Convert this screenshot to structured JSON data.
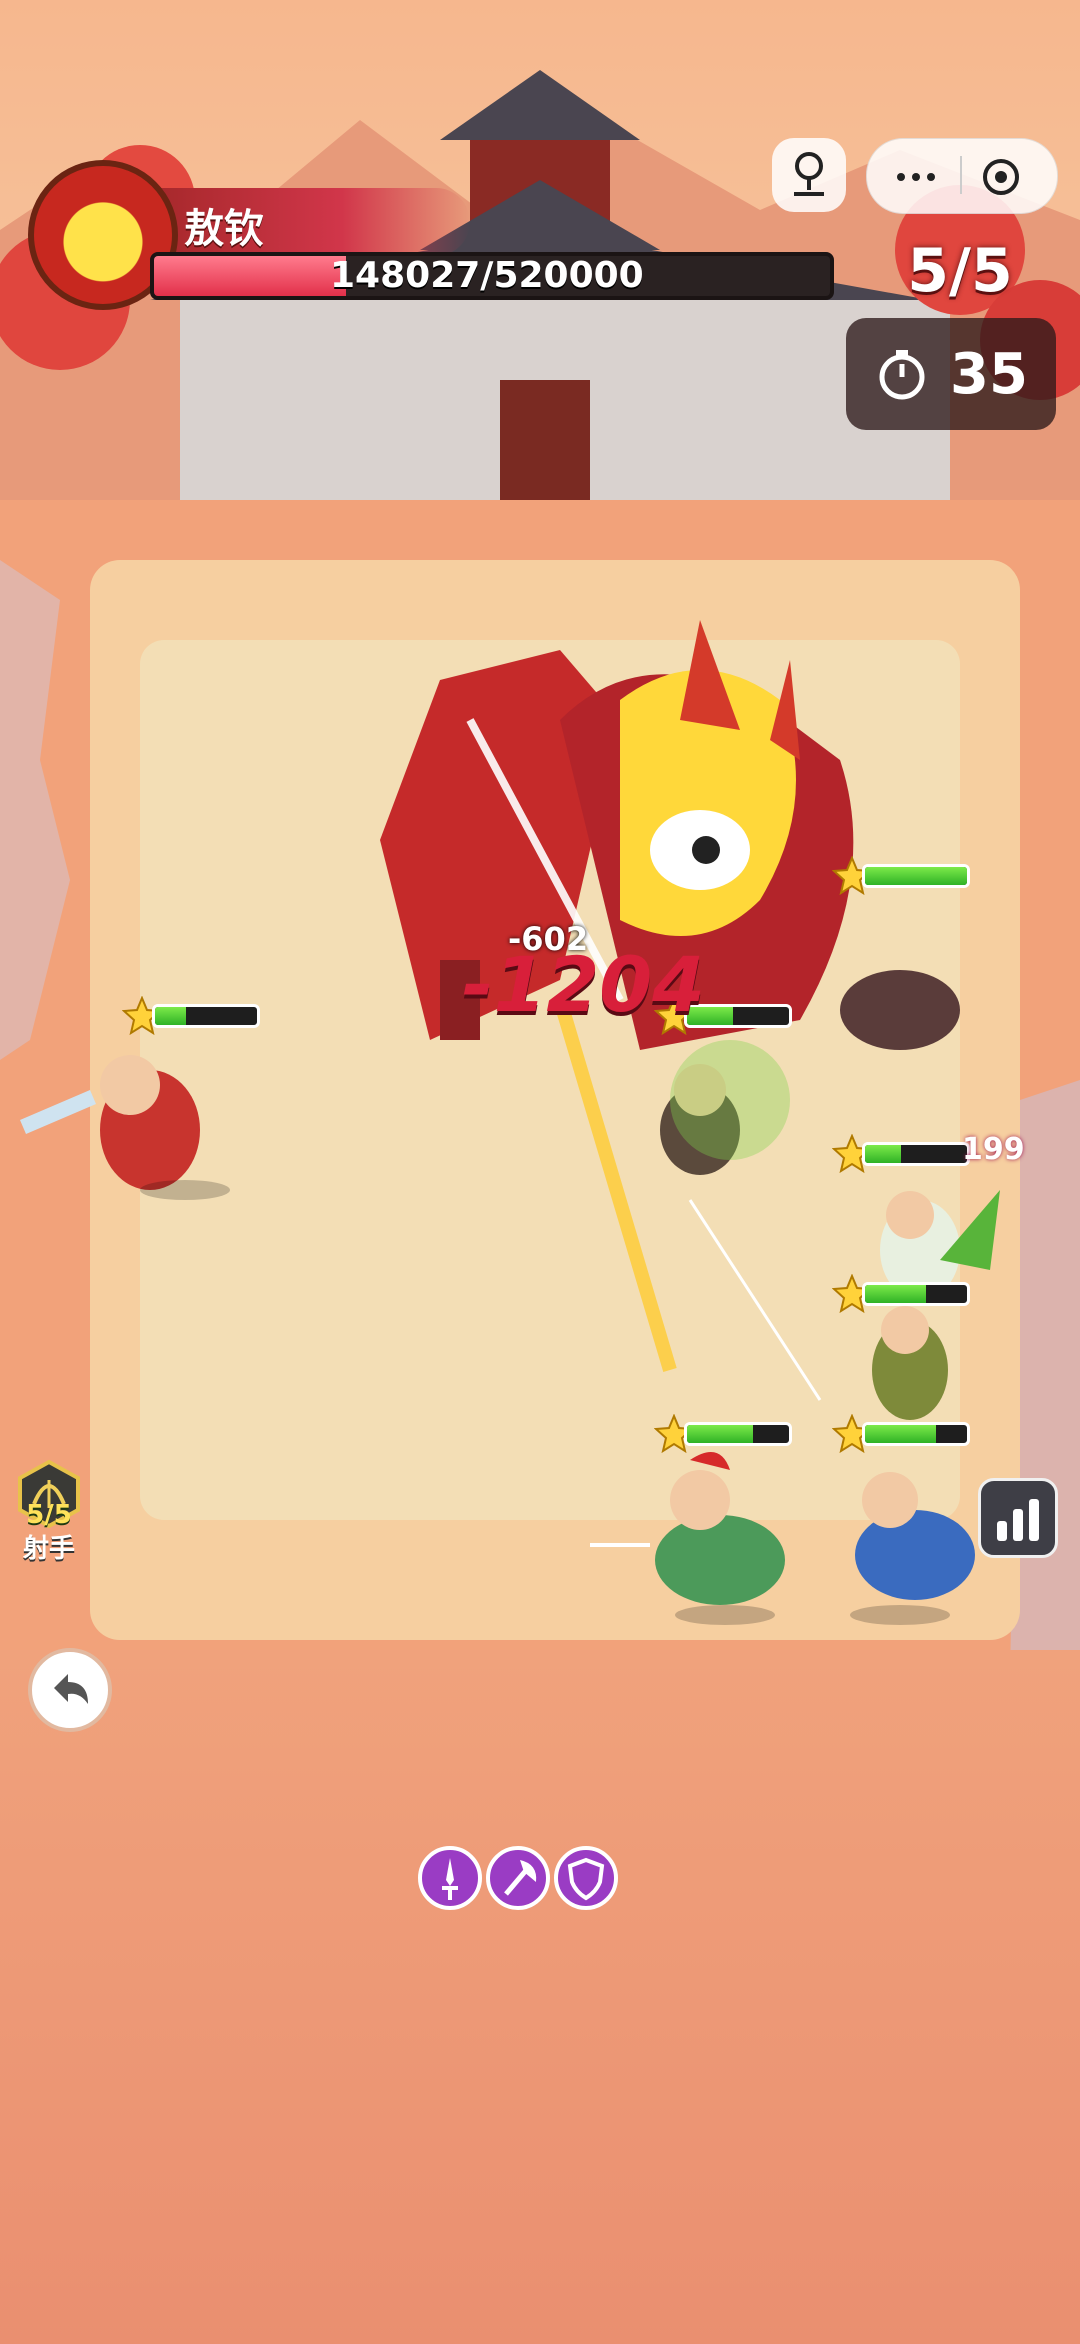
{
  "boss": {
    "name": "敖钦",
    "hp_text": "148027/520000",
    "hp_current": 148027,
    "hp_max": 520000
  },
  "header": {
    "wave": "5/5",
    "timer": "35",
    "capsule_more_icon": "more-dots-icon",
    "capsule_close_icon": "target-close-icon",
    "multiplayer_icon": "joystick-icon"
  },
  "combat": {
    "big_damage": "-1204",
    "small_damage": "-602",
    "side_damage": "199"
  },
  "units": [
    {
      "id": "boss-unit",
      "hp_fraction": 1.0
    },
    {
      "id": "left-warrior",
      "hp_fraction": 0.3
    },
    {
      "id": "boar",
      "hp_fraction": 0.45
    },
    {
      "id": "mid-archer",
      "hp_fraction": 0.35
    },
    {
      "id": "right-mage",
      "hp_fraction": 0.6
    },
    {
      "id": "green-archer",
      "hp_fraction": 0.7
    },
    {
      "id": "guan-archer",
      "hp_fraction": 0.65
    },
    {
      "id": "blue-archer",
      "hp_fraction": 0.6
    }
  ],
  "class_badge": {
    "count": "5/5",
    "name": "射手"
  },
  "skills": [
    {
      "icon": "sword-skill-icon"
    },
    {
      "icon": "axe-skill-icon"
    },
    {
      "icon": "shield-skill-icon"
    }
  ],
  "colors": {
    "hp_red": "#e2304a",
    "unit_hp_green": "#2fb226",
    "skill_purple": "#9a3cc4",
    "damage_red": "#d81f3a"
  }
}
